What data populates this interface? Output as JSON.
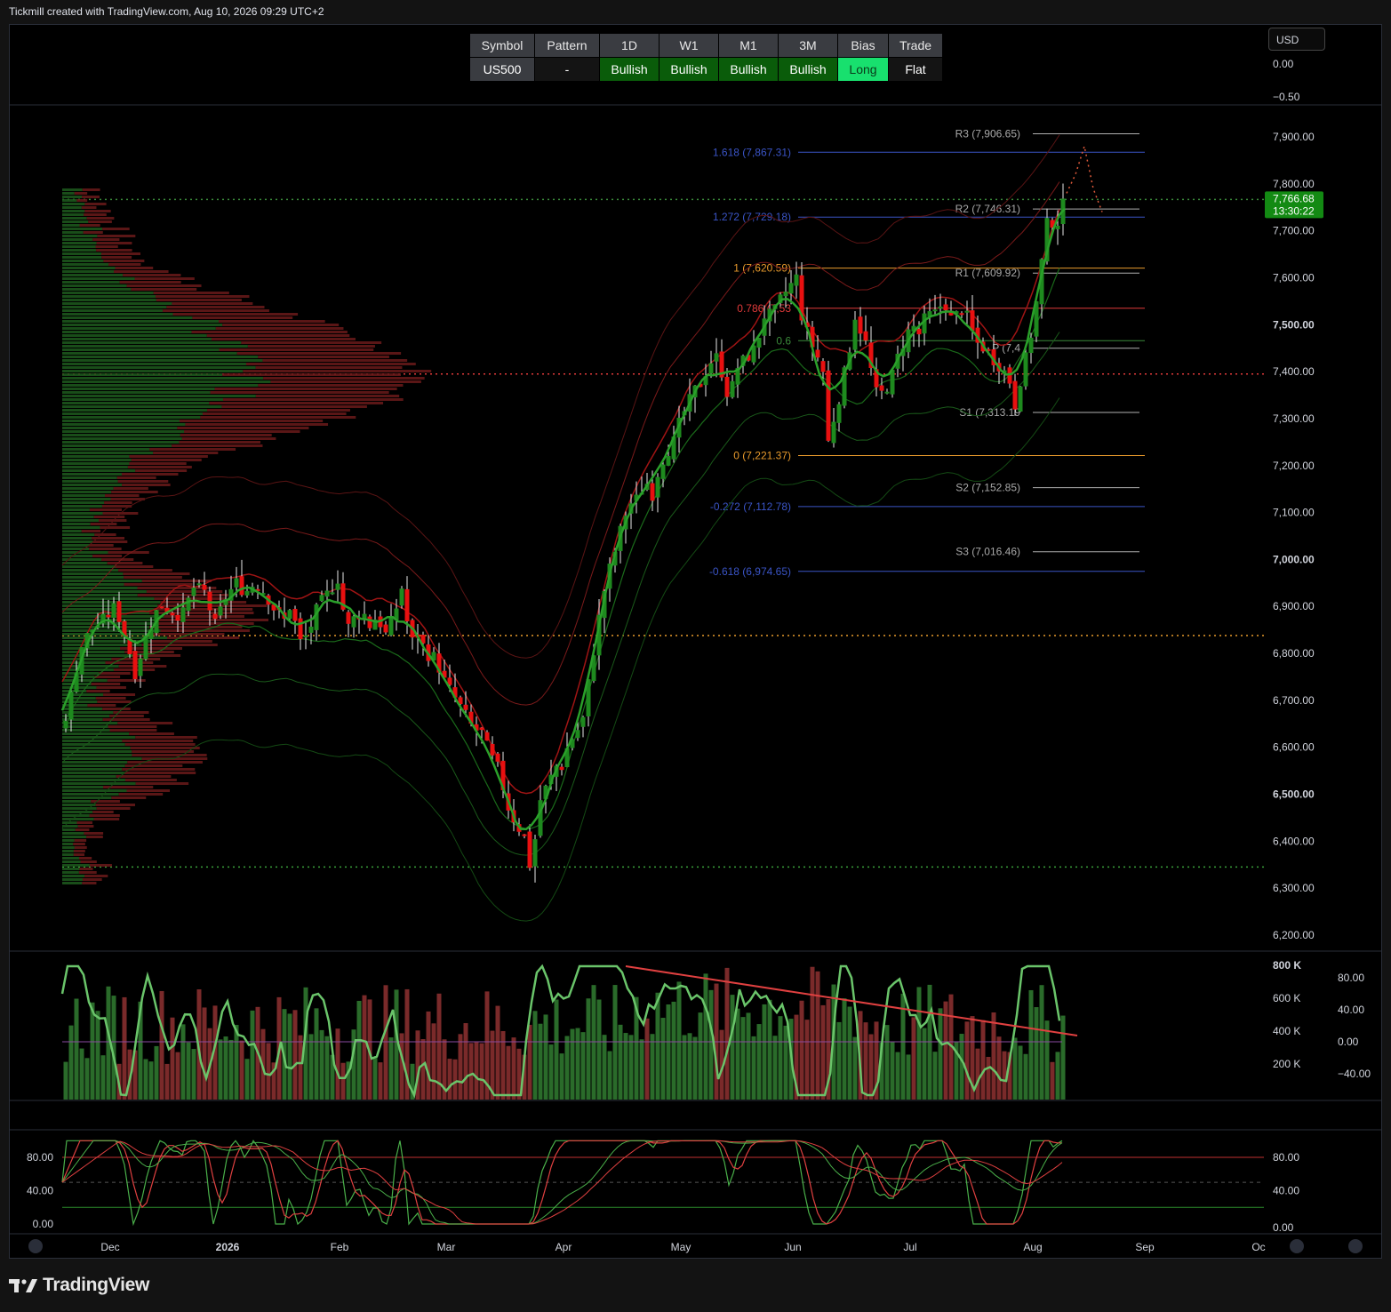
{
  "header": {
    "caption": "Tickmill created with TradingView.com, Aug 10, 2026 09:29 UTC+2",
    "brand": "TradingView",
    "currency": "USD"
  },
  "bias_table": {
    "headers": [
      "Symbol",
      "Pattern",
      "1D",
      "W1",
      "M1",
      "3M",
      "Bias",
      "Trade"
    ],
    "values": [
      "US500",
      "-",
      "Bullish",
      "Bullish",
      "Bullish",
      "Bullish",
      "Long",
      "Flat"
    ],
    "colors": [
      "#3a3c41",
      "#141414",
      "#0a5c0a",
      "#0a5c0a",
      "#0a5c0a",
      "#0a5c0a",
      "#18e06e",
      "#141414"
    ]
  },
  "colors": {
    "bull": "#1e8a1e",
    "bear": "#e81010",
    "price_tag": "#138a13",
    "volume_bull": "#2a6b2a",
    "volume_bear": "#7a2a2a"
  },
  "chart_data": [
    {
      "type": "candlestick",
      "symbol": "US500",
      "last_price": "7,766.68",
      "countdown": "13:30:22",
      "y_axis_ticks": [
        "7,900.00",
        "7,800.00",
        "7,700.00",
        "7,600.00",
        "7,500.00",
        "7,400.00",
        "7,300.00",
        "7,200.00",
        "7,100.00",
        "7,000.00",
        "6,900.00",
        "6,800.00",
        "6,700.00",
        "6,600.00",
        "6,500.00",
        "6,400.00",
        "6,300.00",
        "6,200.00"
      ],
      "y_axis_ticks_top": [
        "0.00",
        "−0.50"
      ],
      "ylim": [
        6170,
        7990
      ],
      "x_axis_ticks": [
        "Dec",
        "2026",
        "Feb",
        "Mar",
        "Apr",
        "May",
        "Jun",
        "Jul",
        "Aug",
        "Sep",
        "Oc"
      ],
      "fib_levels": [
        {
          "label": "1.618 (7,867.31)",
          "value": 7867.31,
          "color": "#3a54c6"
        },
        {
          "label": "1.272 (7,729.18)",
          "value": 7729.18,
          "color": "#3a54c6"
        },
        {
          "label": "1 (7,620.59)",
          "value": 7620.59,
          "color": "#e89a2c"
        },
        {
          "label": "0.786 (7,53",
          "value": 7535,
          "color": "#e03a3a"
        },
        {
          "label": "0.6",
          "value": 7466,
          "color": "#3a8a3a"
        },
        {
          "label": "0 (7,221.37)",
          "value": 7221.37,
          "color": "#e89a2c"
        },
        {
          "label": "-0.272 (7,112.78)",
          "value": 7112.78,
          "color": "#3a54c6"
        },
        {
          "label": "-0.618 (6,974.65)",
          "value": 6974.65,
          "color": "#3a54c6"
        }
      ],
      "pivot_levels": [
        {
          "label": "R3 (7,906.65)",
          "value": 7906.65
        },
        {
          "label": "R2 (7,746.31)",
          "value": 7746.31
        },
        {
          "label": "R1 (7,609.92)",
          "value": 7609.92
        },
        {
          "label": "P (7,4",
          "value": 7450
        },
        {
          "label": "S1 (7,313.19",
          "value": 7313.19
        },
        {
          "label": "S2 (7,152.85)",
          "value": 7152.85
        },
        {
          "label": "S3 (7,016.46)",
          "value": 7016.46
        }
      ],
      "horizontal_lines": [
        {
          "value": 7766.68,
          "style": "dotted",
          "color": "#3a8a3a"
        },
        {
          "value": 7395,
          "style": "dotted",
          "color": "#e03a3a"
        },
        {
          "value": 6838,
          "style": "dotted",
          "color": "#e89a2c"
        },
        {
          "value": 6345,
          "style": "dotted",
          "color": "#3aa03a"
        }
      ],
      "close_path": [
        [
          0,
          6640
        ],
        [
          10,
          6710
        ],
        [
          20,
          6810
        ],
        [
          32,
          6850
        ],
        [
          46,
          6870
        ],
        [
          60,
          6900
        ],
        [
          72,
          6830
        ],
        [
          82,
          6760
        ],
        [
          95,
          6840
        ],
        [
          110,
          6905
        ],
        [
          122,
          6890
        ],
        [
          135,
          6880
        ],
        [
          148,
          6940
        ],
        [
          160,
          6930
        ],
        [
          172,
          6860
        ],
        [
          184,
          6920
        ],
        [
          196,
          6950
        ],
        [
          206,
          6930
        ],
        [
          216,
          6950
        ],
        [
          228,
          6930
        ],
        [
          240,
          6890
        ],
        [
          250,
          6870
        ],
        [
          258,
          6910
        ],
        [
          266,
          6820
        ],
        [
          276,
          6840
        ],
        [
          288,
          6900
        ],
        [
          300,
          6930
        ],
        [
          310,
          6960
        ],
        [
          320,
          6850
        ],
        [
          330,
          6880
        ],
        [
          338,
          6890
        ],
        [
          346,
          6860
        ],
        [
          354,
          6880
        ],
        [
          364,
          6840
        ],
        [
          372,
          6870
        ],
        [
          382,
          6940
        ],
        [
          392,
          6820
        ],
        [
          400,
          6840
        ],
        [
          410,
          6800
        ],
        [
          420,
          6790
        ],
        [
          430,
          6740
        ],
        [
          440,
          6710
        ],
        [
          450,
          6680
        ],
        [
          462,
          6640
        ],
        [
          472,
          6630
        ],
        [
          482,
          6580
        ],
        [
          492,
          6550
        ],
        [
          500,
          6480
        ],
        [
          510,
          6440
        ],
        [
          520,
          6410
        ],
        [
          528,
          6330
        ],
        [
          536,
          6480
        ],
        [
          546,
          6520
        ],
        [
          556,
          6560
        ],
        [
          562,
          6560
        ],
        [
          570,
          6610
        ],
        [
          578,
          6630
        ],
        [
          586,
          6660
        ],
        [
          594,
          6760
        ],
        [
          600,
          6830
        ],
        [
          608,
          6920
        ],
        [
          616,
          6980
        ],
        [
          624,
          7030
        ],
        [
          632,
          7090
        ],
        [
          640,
          7120
        ],
        [
          648,
          7130
        ],
        [
          656,
          7170
        ],
        [
          664,
          7140
        ],
        [
          672,
          7200
        ],
        [
          680,
          7230
        ],
        [
          688,
          7250
        ],
        [
          696,
          7300
        ],
        [
          704,
          7330
        ],
        [
          712,
          7360
        ],
        [
          720,
          7380
        ],
        [
          728,
          7420
        ],
        [
          736,
          7430
        ],
        [
          744,
          7390
        ],
        [
          750,
          7340
        ],
        [
          760,
          7410
        ],
        [
          770,
          7430
        ],
        [
          780,
          7450
        ],
        [
          790,
          7520
        ],
        [
          800,
          7520
        ],
        [
          810,
          7560
        ],
        [
          818,
          7580
        ],
        [
          826,
          7600
        ],
        [
          832,
          7520
        ],
        [
          840,
          7470
        ],
        [
          848,
          7440
        ],
        [
          856,
          7400
        ],
        [
          862,
          7250
        ],
        [
          868,
          7300
        ],
        [
          876,
          7360
        ],
        [
          884,
          7430
        ],
        [
          892,
          7520
        ],
        [
          900,
          7480
        ],
        [
          906,
          7450
        ],
        [
          912,
          7380
        ],
        [
          918,
          7340
        ],
        [
          924,
          7360
        ],
        [
          932,
          7380
        ],
        [
          940,
          7430
        ],
        [
          948,
          7470
        ],
        [
          956,
          7500
        ],
        [
          964,
          7480
        ],
        [
          972,
          7520
        ],
        [
          980,
          7520
        ],
        [
          986,
          7530
        ],
        [
          992,
          7560
        ],
        [
          998,
          7510
        ],
        [
          1006,
          7520
        ],
        [
          1014,
          7540
        ],
        [
          1022,
          7490
        ],
        [
          1030,
          7460
        ],
        [
          1038,
          7450
        ],
        [
          1046,
          7430
        ],
        [
          1052,
          7420
        ],
        [
          1060,
          7400
        ],
        [
          1066,
          7380
        ],
        [
          1072,
          7330
        ],
        [
          1076,
          7370
        ],
        [
          1082,
          7410
        ],
        [
          1088,
          7460
        ],
        [
          1094,
          7520
        ],
        [
          1100,
          7600
        ],
        [
          1106,
          7700
        ],
        [
          1112,
          7740
        ],
        [
          1116,
          7700
        ],
        [
          1122,
          7730
        ],
        [
          1128,
          7766
        ]
      ],
      "forecast_path": [
        [
          1130,
          7780
        ],
        [
          1140,
          7820
        ],
        [
          1150,
          7880
        ],
        [
          1160,
          7790
        ],
        [
          1170,
          7740
        ]
      ],
      "volume_axis_ticks": [
        "800 K",
        "600 K",
        "400 K",
        "200 K"
      ],
      "oscillator_axis_ticks": [
        "80.00",
        "40.00",
        "0.00",
        "−40.00"
      ]
    },
    {
      "type": "line",
      "panel": "stochastic",
      "y_axis_ticks": [
        "80.00",
        "40.00",
        "0.00"
      ],
      "ylim": [
        -5,
        105
      ]
    }
  ]
}
